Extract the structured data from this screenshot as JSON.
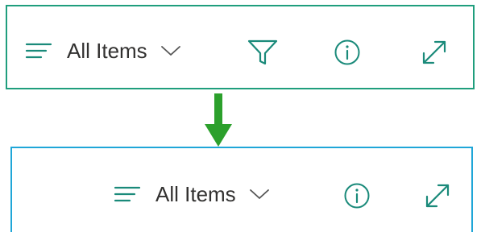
{
  "colors": {
    "top_border": "#1f9e7d",
    "bottom_border": "#1fa6d8",
    "icon_teal": "#1a8a7a",
    "arrow_green": "#2ca02c"
  },
  "toolbar_before": {
    "view_label": "All Items",
    "icons": [
      "hamburger-lines-icon",
      "chevron-down-icon",
      "filter-icon",
      "info-icon",
      "expand-icon"
    ]
  },
  "toolbar_after": {
    "view_label": "All Items",
    "icons": [
      "hamburger-lines-icon",
      "chevron-down-icon",
      "info-icon",
      "expand-icon"
    ]
  },
  "transition_arrow": "arrow-down-icon"
}
